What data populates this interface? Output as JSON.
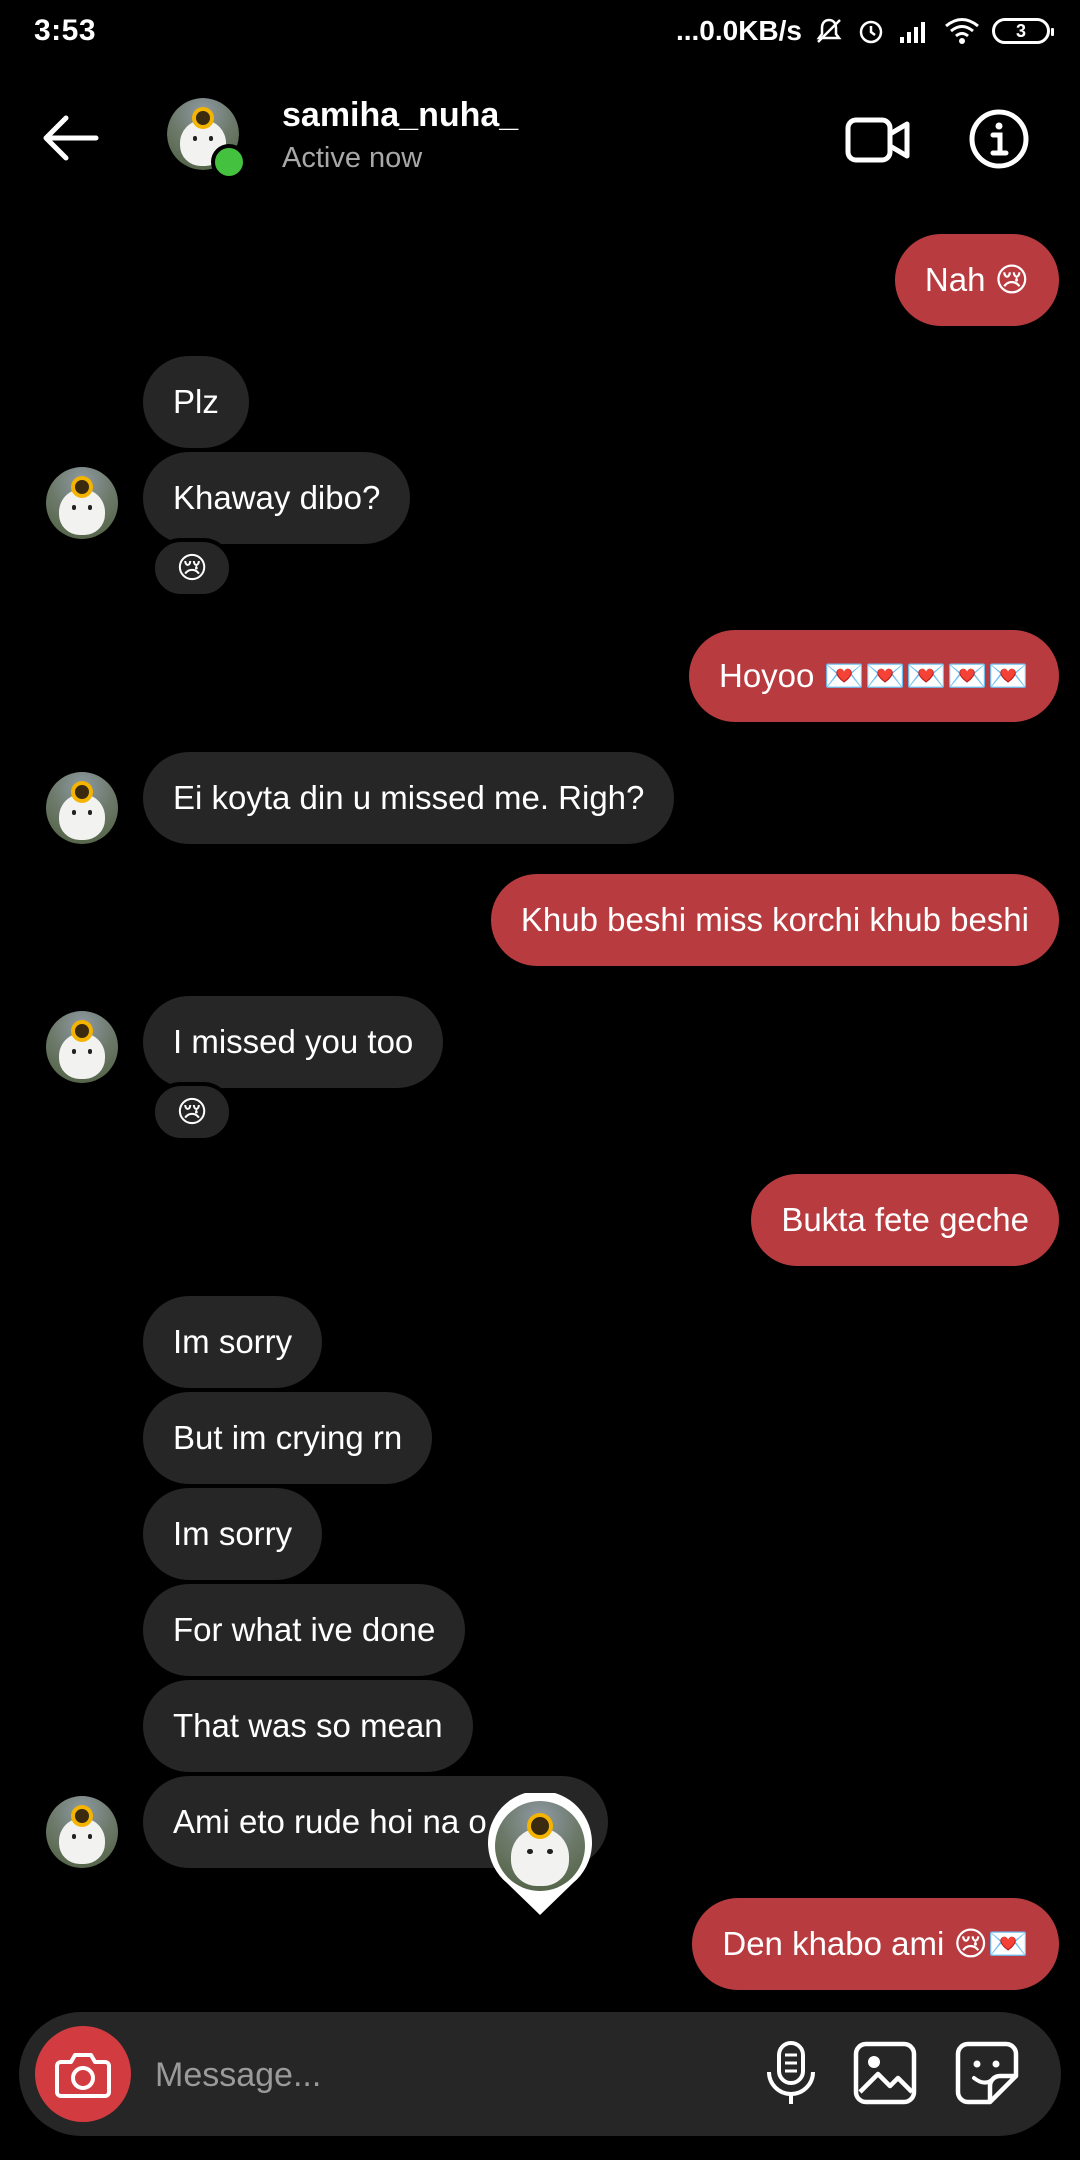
{
  "status_bar": {
    "time": "3:53",
    "network": "...0.0KB/s",
    "battery": "3"
  },
  "header": {
    "username": "samiha_nuha_",
    "status": "Active now"
  },
  "messages": [
    {
      "side": "sent",
      "text": "Nah 😢"
    },
    {
      "side": "received",
      "text": "Plz"
    },
    {
      "side": "received",
      "text": "Khaway dibo?",
      "reaction": "😢"
    },
    {
      "side": "sent",
      "text": "Hoyoo 💌💌💌💌💌"
    },
    {
      "side": "received",
      "text": "Ei koyta din u missed me. Righ?"
    },
    {
      "side": "sent",
      "text": "Khub beshi miss korchi khub beshi"
    },
    {
      "side": "received",
      "text": "I missed you too",
      "reaction": "😢"
    },
    {
      "side": "sent",
      "text": "Bukta fete geche"
    },
    {
      "side": "received",
      "text": "Im sorry"
    },
    {
      "side": "received",
      "text": "But im crying rn"
    },
    {
      "side": "received",
      "text": "Im sorry"
    },
    {
      "side": "received",
      "text": "For what ive done"
    },
    {
      "side": "received",
      "text": "That was so mean"
    },
    {
      "side": "received",
      "text": "Ami eto rude hoi na o"
    },
    {
      "side": "sent",
      "text": "Den khabo ami 😢💌"
    }
  ],
  "composer": {
    "placeholder": "Message..."
  },
  "icons": {
    "back": "back-arrow-icon",
    "video": "video-call-icon",
    "info": "info-icon",
    "camera": "camera-icon",
    "mic": "microphone-icon",
    "gallery": "gallery-icon",
    "sticker": "sticker-icon"
  },
  "colors": {
    "background": "#000000",
    "received_bubble": "#262626",
    "sent_bubble": "#b83b3f",
    "camera_button": "#d23c40",
    "online_dot": "#44c13f"
  }
}
